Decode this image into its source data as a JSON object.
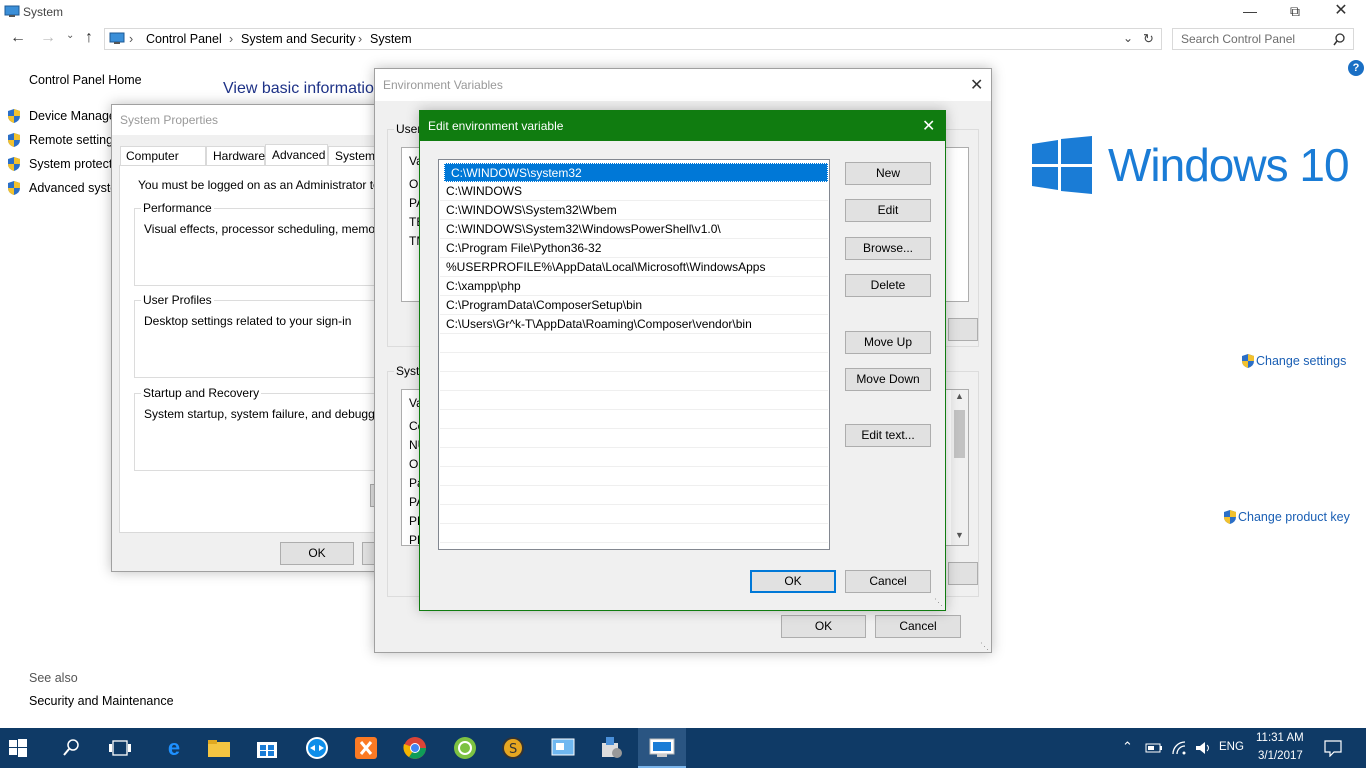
{
  "window": {
    "title": "System"
  },
  "address_bar": {
    "breadcrumbs": [
      "Control Panel",
      "System and Security",
      "System"
    ],
    "search_placeholder": "Search Control Panel"
  },
  "sidebar": {
    "home": "Control Panel Home",
    "items": [
      {
        "label": "Device Manager"
      },
      {
        "label": "Remote settings"
      },
      {
        "label": "System protection"
      },
      {
        "label": "Advanced system settings"
      }
    ],
    "see_also_title": "See also",
    "see_also_items": [
      "Security and Maintenance"
    ]
  },
  "main": {
    "heading": "View basic information about your computer",
    "change_settings": "Change settings",
    "change_product_key": "Change product key",
    "logo_text": "Windows 10"
  },
  "system_properties": {
    "title": "System Properties",
    "tabs": [
      "Computer Name",
      "Hardware",
      "Advanced",
      "System Protection"
    ],
    "active_tab": "Advanced",
    "admin_note": "You must be logged on as an Administrator to make most of these changes.",
    "performance_label": "Performance",
    "performance_desc": "Visual effects, processor scheduling, memory usage, and virtual memory",
    "profiles_label": "User Profiles",
    "profiles_desc": "Desktop settings related to your sign-in",
    "startup_label": "Startup and Recovery",
    "startup_desc": "System startup, system failure, and debugging information",
    "ok": "OK"
  },
  "env_vars": {
    "title": "Environment Variables",
    "user_group": "User variables",
    "user_header": "Va",
    "user_rows": [
      "On",
      "PA",
      "TE",
      "TM"
    ],
    "system_group": "System variables",
    "system_header": "Va",
    "system_rows": [
      "Co",
      "NU",
      "OS",
      "Pa",
      "PA",
      "PR",
      "PR"
    ],
    "ok": "OK",
    "cancel": "Cancel"
  },
  "edit_dialog": {
    "title": "Edit environment variable",
    "entries": [
      "C:\\WINDOWS\\system32",
      "C:\\WINDOWS",
      "C:\\WINDOWS\\System32\\Wbem",
      "C:\\WINDOWS\\System32\\WindowsPowerShell\\v1.0\\",
      "C:\\Program File\\Python36-32",
      "%USERPROFILE%\\AppData\\Local\\Microsoft\\WindowsApps",
      "C:\\xampp\\php",
      "C:\\ProgramData\\ComposerSetup\\bin",
      "C:\\Users\\Gr^k-T\\AppData\\Roaming\\Composer\\vendor\\bin"
    ],
    "selected_index": 0,
    "buttons": {
      "new": "New",
      "edit": "Edit",
      "browse": "Browse...",
      "delete": "Delete",
      "move_up": "Move Up",
      "move_down": "Move Down",
      "edit_text": "Edit text..."
    },
    "ok": "OK",
    "cancel": "Cancel",
    "accent": "#107c10"
  },
  "taskbar": {
    "time": "11:31 AM",
    "date": "3/1/2017",
    "lang": "ENG",
    "color": "#0f3a66"
  }
}
